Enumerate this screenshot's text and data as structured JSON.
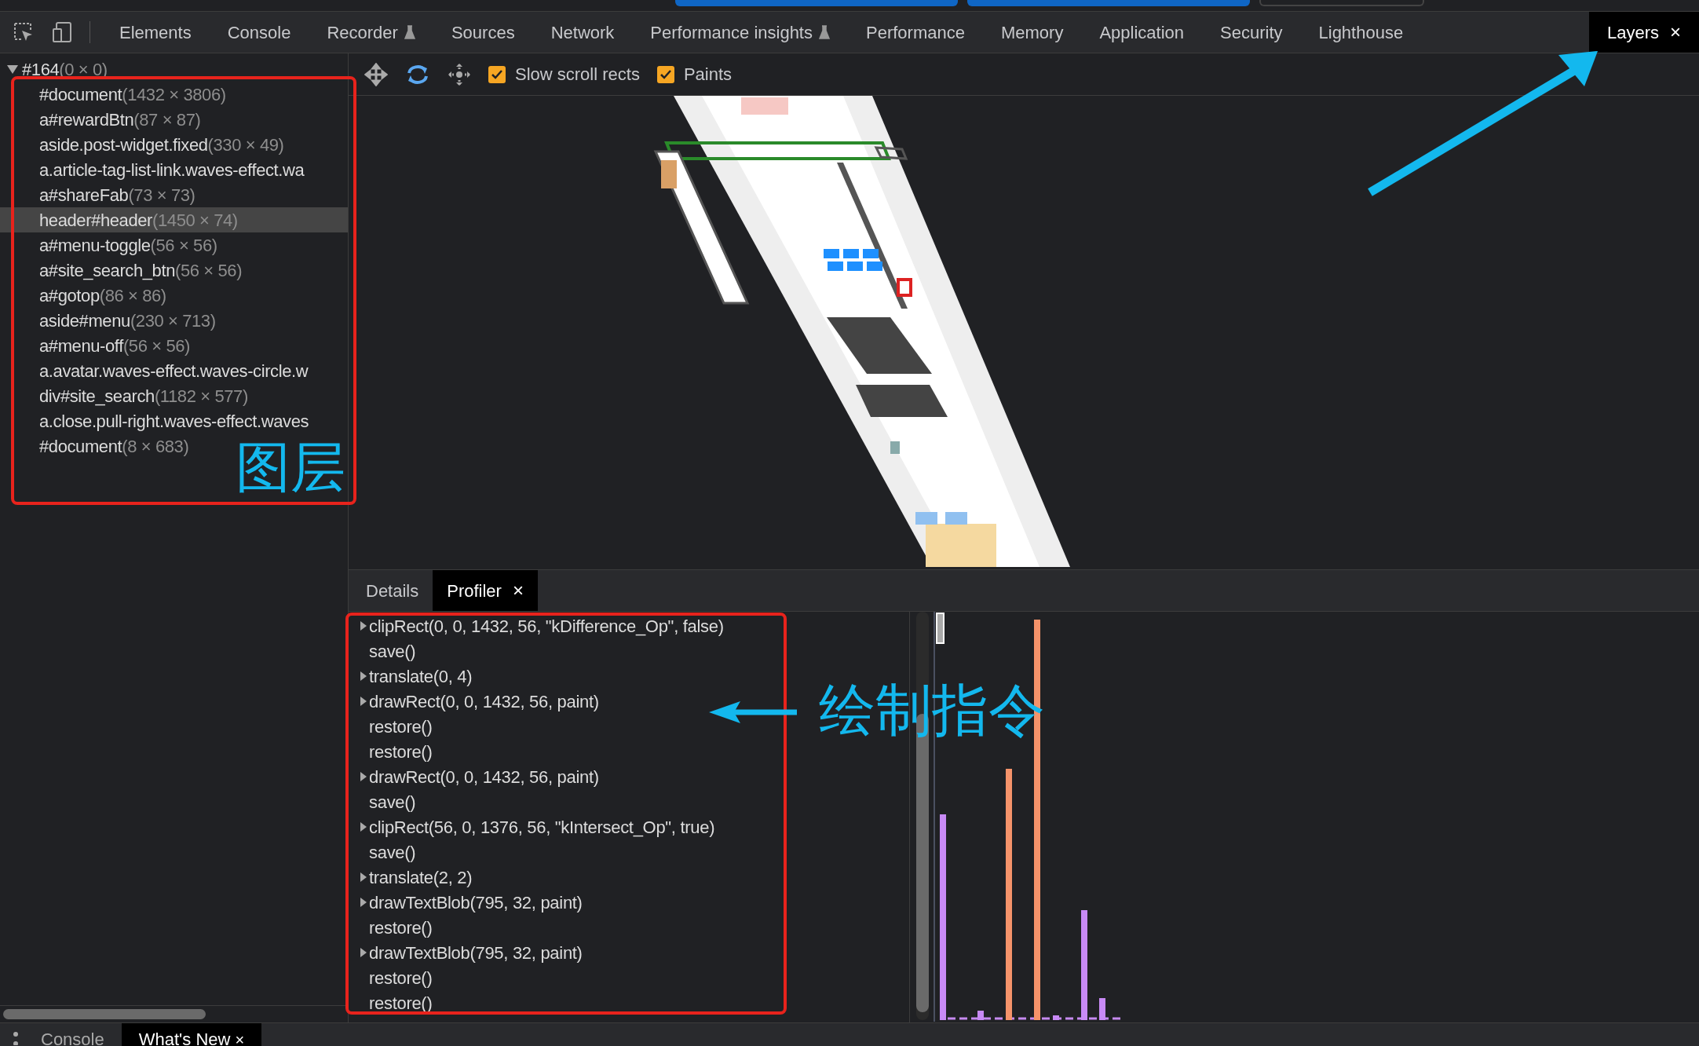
{
  "window_tabs": [
    {
      "selected": true
    },
    {
      "selected": true
    },
    {
      "selected": false
    }
  ],
  "main_tabs": [
    {
      "label": "Elements",
      "selected": false,
      "experimental": false
    },
    {
      "label": "Console",
      "selected": false,
      "experimental": false
    },
    {
      "label": "Recorder",
      "selected": false,
      "experimental": true
    },
    {
      "label": "Sources",
      "selected": false,
      "experimental": false
    },
    {
      "label": "Network",
      "selected": false,
      "experimental": false
    },
    {
      "label": "Performance insights",
      "selected": false,
      "experimental": true
    },
    {
      "label": "Performance",
      "selected": false,
      "experimental": false
    },
    {
      "label": "Memory",
      "selected": false,
      "experimental": false
    },
    {
      "label": "Application",
      "selected": false,
      "experimental": false
    },
    {
      "label": "Security",
      "selected": false,
      "experimental": false
    },
    {
      "label": "Lighthouse",
      "selected": false,
      "experimental": false
    },
    {
      "label": "Layers",
      "selected": true,
      "experimental": false,
      "close": "×"
    }
  ],
  "layer_tree": {
    "label": "#164",
    "size": "(0 × 0)",
    "expanded": true,
    "children": [
      {
        "label": "#document",
        "size": "(1432 × 3806)",
        "selected": false
      },
      {
        "label": "a#rewardBtn",
        "size": "(87 × 87)",
        "selected": false
      },
      {
        "label": "aside.post-widget.fixed",
        "size": "(330 × 49)",
        "selected": false
      },
      {
        "label": "a.article-tag-list-link.waves-effect.wa",
        "selected": false
      },
      {
        "label": "a#shareFab",
        "size": "(73 × 73)",
        "selected": false
      },
      {
        "label": "header#header",
        "size": "(1450 × 74)",
        "selected": true
      },
      {
        "label": "a#menu-toggle",
        "size": "(56 × 56)",
        "selected": false
      },
      {
        "label": "a#site_search_btn",
        "size": "(56 × 56)",
        "selected": false
      },
      {
        "label": "a#gotop",
        "size": "(86 × 86)",
        "selected": false
      },
      {
        "label": "aside#menu",
        "size": "(230 × 713)",
        "selected": false
      },
      {
        "label": "a#menu-off",
        "size": "(56 × 56)",
        "selected": false
      },
      {
        "label": "a.avatar.waves-effect.waves-circle.w",
        "selected": false
      },
      {
        "label": "div#site_search",
        "size": "(1182 × 577)",
        "selected": false
      },
      {
        "label": "a.close.pull-right.waves-effect.waves",
        "selected": false
      },
      {
        "label": "#document",
        "size": "(8 × 683)",
        "selected": false
      }
    ]
  },
  "toolbar": {
    "checkboxes": [
      {
        "label": "Slow scroll rects",
        "checked": true
      },
      {
        "label": "Paints",
        "checked": true
      }
    ]
  },
  "detail_tabs": [
    {
      "label": "Details",
      "selected": false
    },
    {
      "label": "Profiler",
      "selected": true,
      "close": "×"
    }
  ],
  "commands": [
    {
      "text": "clipRect(0, 0, 1432, 56, \"kDifference_Op\", false)",
      "expandable": true
    },
    {
      "text": "save()",
      "expandable": false
    },
    {
      "text": "translate(0, 4)",
      "expandable": true
    },
    {
      "text": "drawRect(0, 0, 1432, 56, paint)",
      "expandable": true
    },
    {
      "text": "restore()",
      "expandable": false
    },
    {
      "text": "restore()",
      "expandable": false
    },
    {
      "text": "drawRect(0, 0, 1432, 56, paint)",
      "expandable": true
    },
    {
      "text": "save()",
      "expandable": false
    },
    {
      "text": "clipRect(56, 0, 1376, 56, \"kIntersect_Op\", true)",
      "expandable": true
    },
    {
      "text": "save()",
      "expandable": false
    },
    {
      "text": "translate(2, 2)",
      "expandable": true
    },
    {
      "text": "drawTextBlob(795, 32, paint)",
      "expandable": true
    },
    {
      "text": "restore()",
      "expandable": false
    },
    {
      "text": "drawTextBlob(795, 32, paint)",
      "expandable": true
    },
    {
      "text": "restore()",
      "expandable": false
    },
    {
      "text": "restore()",
      "expandable": false
    }
  ],
  "annotations": [
    {
      "kind": "layers",
      "text": "图层"
    },
    {
      "kind": "commands",
      "text": "绘制指令"
    }
  ],
  "drawer_tabs": [
    {
      "label": "Console",
      "selected": false
    },
    {
      "label": "What's New",
      "selected": true,
      "close": "×"
    }
  ]
}
